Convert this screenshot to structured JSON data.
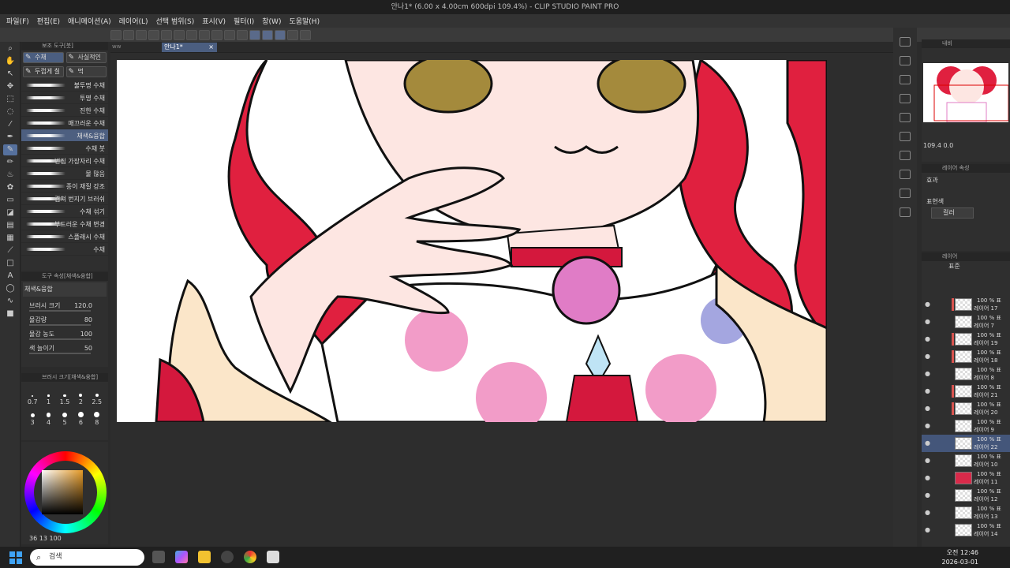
{
  "title": "안나1* (6.00 x 4.00cm 600dpi 109.4%) - CLIP STUDIO PAINT PRO",
  "menu": [
    "파일(F)",
    "편집(E)",
    "애니메이션(A)",
    "레이어(L)",
    "선택 범위(S)",
    "표시(V)",
    "필터(I)",
    "창(W)",
    "도움말(H)"
  ],
  "subtool": {
    "header": "보조 도구[붓]",
    "tabs": [
      "수채",
      "사실적인",
      "두껍게 칠",
      "먹"
    ],
    "brushes": [
      "불투명 수채",
      "투명 수채",
      "진한 수채",
      "매끄러운 수채",
      "채색&융합",
      "수채 붓",
      "번짐 가장자리 수채",
      "물 많음",
      "종이 재질 강조",
      "겹쳐 번지기 브러쉬",
      "수채 섞기",
      "부드러운 수채 변경",
      "스플래시 수채",
      "수채"
    ]
  },
  "toolprop": {
    "header": "도구 속성[채색&융합]",
    "preview": "채색&융합",
    "rows": [
      {
        "label": "브러시 크기",
        "value": "120.0"
      },
      {
        "label": "물감량",
        "value": "80"
      },
      {
        "label": "물감 농도",
        "value": "100"
      },
      {
        "label": "색 늘이기",
        "value": "50"
      }
    ]
  },
  "brushsize": {
    "header": "브러시 크기[채색&융합]",
    "sizes": [
      "0.7",
      "1",
      "1.5",
      "2",
      "2.5",
      "3",
      "4",
      "5",
      "6",
      "8"
    ]
  },
  "color": {
    "h": "36",
    "s": "13",
    "v": "100",
    "current": "#e69b28"
  },
  "document": {
    "tab": "안나1*",
    "tabprefix": "ww"
  },
  "navigator": {
    "header": "내비",
    "zoom": "109.4",
    "rotate": "0.0"
  },
  "layerprop": {
    "header": "레이어 속성",
    "effect_label": "효과",
    "express_label": "표현색",
    "express_value": "컬러"
  },
  "layers": {
    "header": "레이어",
    "blend": "표준",
    "rows": [
      {
        "pct": "100 % 표",
        "name": "레이어 17",
        "flag": true,
        "sel": false,
        "thumb": "check"
      },
      {
        "pct": "100 % 표",
        "name": "레이어 7",
        "flag": false,
        "sel": false,
        "thumb": "check"
      },
      {
        "pct": "100 % 표",
        "name": "레이어 19",
        "flag": true,
        "sel": false,
        "thumb": "check"
      },
      {
        "pct": "100 % 표",
        "name": "레이어 18",
        "flag": true,
        "sel": false,
        "thumb": "check"
      },
      {
        "pct": "100 % 표",
        "name": "레이어 8",
        "flag": false,
        "sel": false,
        "thumb": "check"
      },
      {
        "pct": "100 % 표",
        "name": "레이어 21",
        "flag": true,
        "sel": false,
        "thumb": "check"
      },
      {
        "pct": "100 % 표",
        "name": "레이어 20",
        "flag": true,
        "sel": false,
        "thumb": "check"
      },
      {
        "pct": "100 % 표",
        "name": "레이어 9",
        "flag": false,
        "sel": false,
        "thumb": "check"
      },
      {
        "pct": "100 % 표",
        "name": "레이어 22",
        "flag": false,
        "sel": true,
        "thumb": "check"
      },
      {
        "pct": "100 % 표",
        "name": "레이어 10",
        "flag": false,
        "sel": false,
        "thumb": "check"
      },
      {
        "pct": "100 % 표",
        "name": "레이어 11",
        "flag": false,
        "sel": false,
        "thumb": "red"
      },
      {
        "pct": "100 % 표",
        "name": "레이어 12",
        "flag": false,
        "sel": false,
        "thumb": "check"
      },
      {
        "pct": "100 % 표",
        "name": "레이어 13",
        "flag": false,
        "sel": false,
        "thumb": "check"
      },
      {
        "pct": "100 % 표",
        "name": "레이어 14",
        "flag": false,
        "sel": false,
        "thumb": "check"
      }
    ]
  },
  "taskbar": {
    "search": "검색",
    "time": "오전 12:46",
    "date": "2026-03-01"
  }
}
